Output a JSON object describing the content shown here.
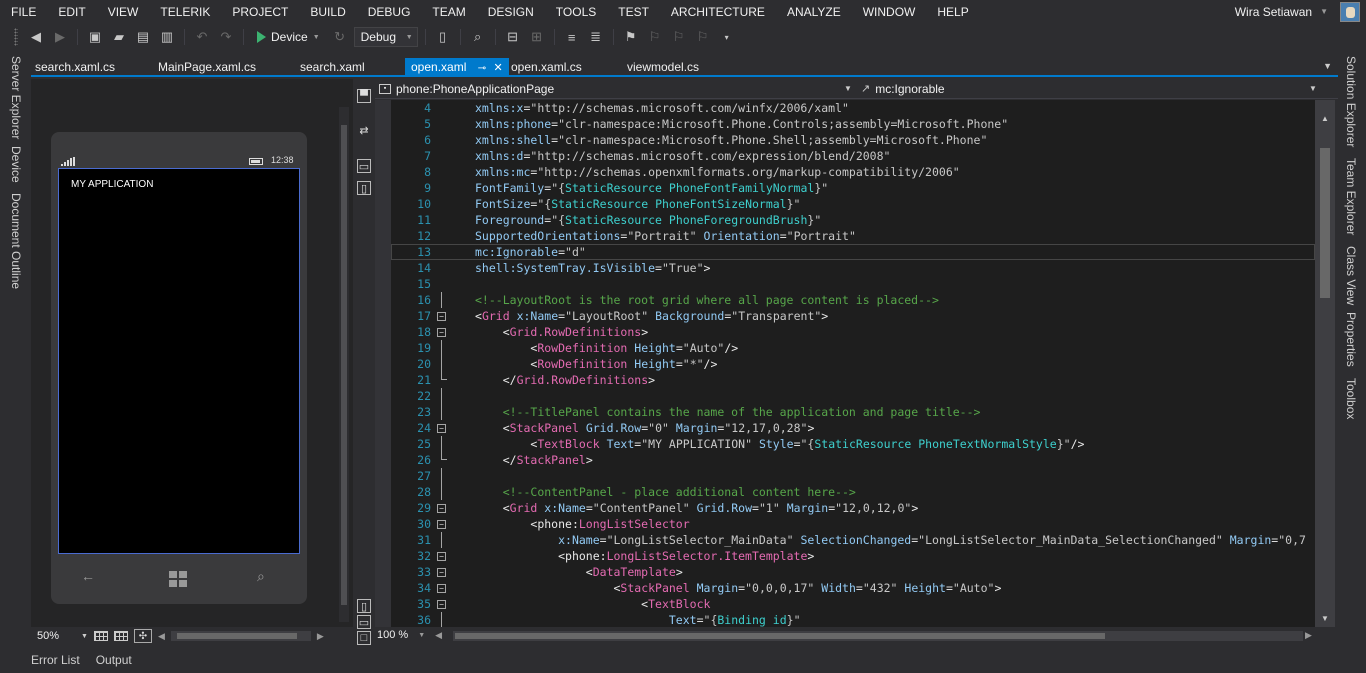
{
  "menu": [
    "FILE",
    "EDIT",
    "VIEW",
    "TELERIK",
    "PROJECT",
    "BUILD",
    "DEBUG",
    "TEAM",
    "DESIGN",
    "TOOLS",
    "TEST",
    "ARCHITECTURE",
    "ANALYZE",
    "WINDOW",
    "HELP"
  ],
  "user": {
    "name": "Wira Setiawan"
  },
  "toolbar": {
    "run_target": "Device",
    "configuration": "Debug"
  },
  "left_tool_windows": [
    "Server Explorer",
    "Device",
    "Document Outline"
  ],
  "right_tool_windows": [
    "Solution Explorer",
    "Team Explorer",
    "Class View",
    "Properties",
    "Toolbox"
  ],
  "tabs": [
    {
      "label": "search.xaml.cs",
      "active": false
    },
    {
      "label": "MainPage.xaml.cs",
      "active": false
    },
    {
      "label": "search.xaml",
      "active": false
    },
    {
      "label": "open.xaml",
      "active": true
    },
    {
      "label": "open.xaml.cs",
      "active": false
    },
    {
      "label": "viewmodel.cs",
      "active": false
    }
  ],
  "designer": {
    "phone_time": "12:38",
    "app_title": "MY APPLICATION",
    "zoom": "50%"
  },
  "navbar": {
    "left": "phone:PhoneApplicationPage",
    "right": "mc:Ignorable"
  },
  "editor": {
    "zoom": "100 %",
    "current_line": 13,
    "lines": [
      {
        "n": "4",
        "text": "xmlns:x=\"http://schemas.microsoft.com/winfx/2006/xaml\""
      },
      {
        "n": "5",
        "text": "xmlns:phone=\"clr-namespace:Microsoft.Phone.Controls;assembly=Microsoft.Phone\""
      },
      {
        "n": "6",
        "text": "xmlns:shell=\"clr-namespace:Microsoft.Phone.Shell;assembly=Microsoft.Phone\""
      },
      {
        "n": "7",
        "text": "xmlns:d=\"http://schemas.microsoft.com/expression/blend/2008\""
      },
      {
        "n": "8",
        "text": "xmlns:mc=\"http://schemas.openxmlformats.org/markup-compatibility/2006\""
      },
      {
        "n": "9",
        "text": "FontFamily=\"{StaticResource PhoneFontFamilyNormal}\""
      },
      {
        "n": "10",
        "text": "FontSize=\"{StaticResource PhoneFontSizeNormal}\""
      },
      {
        "n": "11",
        "text": "Foreground=\"{StaticResource PhoneForegroundBrush}\""
      },
      {
        "n": "12",
        "text": "SupportedOrientations=\"Portrait\" Orientation=\"Portrait\""
      },
      {
        "n": "13",
        "text": "mc:Ignorable=\"d\""
      },
      {
        "n": "14",
        "text": "shell:SystemTray.IsVisible=\"True\">"
      },
      {
        "n": "15",
        "text": ""
      },
      {
        "n": "16",
        "text": "<!--LayoutRoot is the root grid where all page content is placed-->"
      },
      {
        "n": "17",
        "text": "<Grid x:Name=\"LayoutRoot\" Background=\"Transparent\">"
      },
      {
        "n": "18",
        "text": "    <Grid.RowDefinitions>"
      },
      {
        "n": "19",
        "text": "        <RowDefinition Height=\"Auto\"/>"
      },
      {
        "n": "20",
        "text": "        <RowDefinition Height=\"*\"/>"
      },
      {
        "n": "21",
        "text": "    </Grid.RowDefinitions>"
      },
      {
        "n": "22",
        "text": ""
      },
      {
        "n": "23",
        "text": "    <!--TitlePanel contains the name of the application and page title-->"
      },
      {
        "n": "24",
        "text": "    <StackPanel Grid.Row=\"0\" Margin=\"12,17,0,28\">"
      },
      {
        "n": "25",
        "text": "        <TextBlock Text=\"MY APPLICATION\" Style=\"{StaticResource PhoneTextNormalStyle}\"/>"
      },
      {
        "n": "26",
        "text": "    </StackPanel>"
      },
      {
        "n": "27",
        "text": ""
      },
      {
        "n": "28",
        "text": "    <!--ContentPanel - place additional content here-->"
      },
      {
        "n": "29",
        "text": "    <Grid x:Name=\"ContentPanel\" Grid.Row=\"1\" Margin=\"12,0,12,0\">"
      },
      {
        "n": "30",
        "text": "        <phone:LongListSelector"
      },
      {
        "n": "31",
        "text": "            x:Name=\"LongListSelector_MainData\" SelectionChanged=\"LongListSelector_MainData_SelectionChanged\" Margin=\"0,7"
      },
      {
        "n": "32",
        "text": "            <phone:LongListSelector.ItemTemplate>"
      },
      {
        "n": "33",
        "text": "                <DataTemplate>"
      },
      {
        "n": "34",
        "text": "                    <StackPanel Margin=\"0,0,0,17\" Width=\"432\" Height=\"Auto\">"
      },
      {
        "n": "35",
        "text": "                        <TextBlock"
      },
      {
        "n": "36",
        "text": "                            Text=\"{Binding id}\""
      }
    ]
  },
  "bottom_tabs": [
    "Error List",
    "Output"
  ]
}
